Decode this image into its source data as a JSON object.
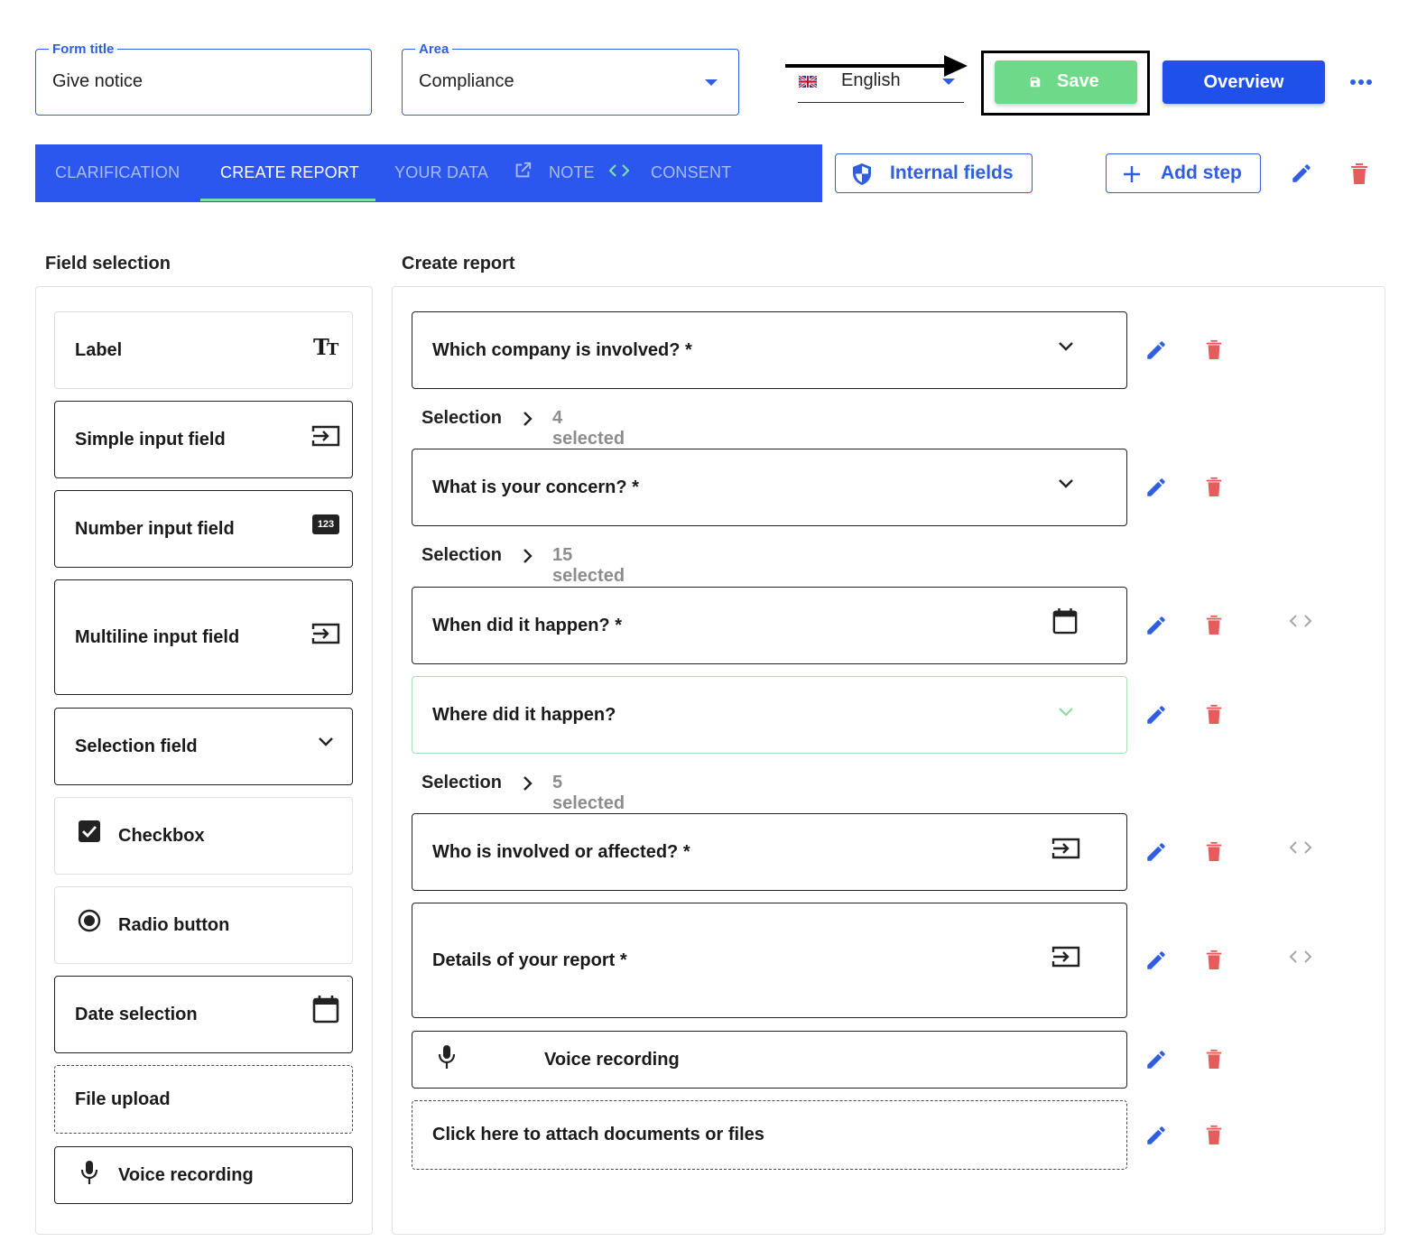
{
  "header": {
    "form_title_label": "Form title",
    "form_title_value": "Give notice",
    "area_label": "Area",
    "area_value": "Compliance",
    "language": "English",
    "save_label": "Save",
    "overview_label": "Overview",
    "more_icon": "more-horizontal-icon"
  },
  "tabs": [
    {
      "label": "CLARIFICATION",
      "active": false
    },
    {
      "label": "CREATE REPORT",
      "active": true
    },
    {
      "label": "YOUR DATA",
      "active": false
    },
    {
      "label": "NOTE",
      "active": false
    },
    {
      "label": "CONSENT",
      "active": false
    }
  ],
  "toolbar": {
    "internal_fields_label": "Internal fields",
    "add_step_label": "Add step"
  },
  "field_selection": {
    "title": "Field selection",
    "items": [
      {
        "label": "Label",
        "icon": "text-format-icon"
      },
      {
        "label": "Simple input field",
        "icon": "input-icon"
      },
      {
        "label": "Number input field",
        "icon": "numbers-icon",
        "icon_text": "123"
      },
      {
        "label": "Multiline input field",
        "icon": "input-icon"
      },
      {
        "label": "Selection field",
        "icon": "chevron-down-icon"
      },
      {
        "label": "Checkbox",
        "icon": "checkbox-checked-icon"
      },
      {
        "label": "Radio button",
        "icon": "radio-checked-icon"
      },
      {
        "label": "Date selection",
        "icon": "calendar-icon"
      },
      {
        "label": "File upload",
        "icon": ""
      },
      {
        "label": "Voice recording",
        "icon": "microphone-icon"
      }
    ]
  },
  "create_report": {
    "title": "Create report",
    "fields": [
      {
        "label": "Which company is involved? *",
        "icon": "chevron-down-icon"
      },
      {
        "label": "What is your concern? *",
        "icon": "chevron-down-icon"
      },
      {
        "label": "When did it happen? *",
        "icon": "calendar-icon"
      },
      {
        "label": "Where did it happen?",
        "icon": "chevron-down-icon"
      },
      {
        "label": "Who is involved or affected? *",
        "icon": "input-icon"
      },
      {
        "label": "Details of your report *",
        "icon": "input-icon"
      },
      {
        "label": "Voice recording",
        "icon": "microphone-icon"
      },
      {
        "label": "Click here to attach documents or files",
        "icon": ""
      }
    ],
    "selections": [
      {
        "label": "Selection",
        "count": "4 selected"
      },
      {
        "label": "Selection",
        "count": "15 selected"
      },
      {
        "label": "Selection",
        "count": "5 selected"
      }
    ]
  },
  "colors": {
    "primary": "#1f50ea",
    "tabbar": "#2c57ef",
    "save": "#6fd98a",
    "delete": "#e65c5c",
    "muted": "#8c8c8c"
  }
}
